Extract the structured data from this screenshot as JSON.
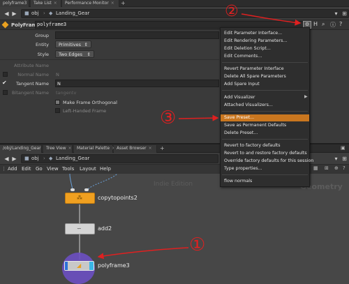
{
  "top_tabs": [
    {
      "label": "polyframe3"
    },
    {
      "label": "Take List"
    },
    {
      "label": "Performance Monitor"
    }
  ],
  "nav": {
    "path_root": "obj",
    "path_node": "Landing_Gear"
  },
  "param_header": {
    "node_type": "PolyFrame",
    "node_name": "polyframe3"
  },
  "params": {
    "group_label": "Group",
    "entity_label": "Entity",
    "entity_value": "Primitives",
    "style_label": "Style",
    "style_value": "Two Edges",
    "attribute_name_label": "Attribute Name",
    "normal_name_label": "Normal Name",
    "normal_name_value": "N",
    "tangent_name_label": "Tangent Name",
    "tangent_name_value": "N",
    "bitangent_name_label": "Bitangent Name",
    "bitangent_name_value": "tangentv",
    "make_frame_orthogonal": "Make Frame Orthogonal",
    "left_handed_frame": "Left-Handed Frame"
  },
  "context_menu": {
    "items": [
      {
        "label": "Edit Parameter Interface..."
      },
      {
        "label": "Edit Rendering Parameters..."
      },
      {
        "label": "Edit Deletion Script..."
      },
      {
        "label": "Edit Comments..."
      },
      {
        "label": "Revert Parameter Interface"
      },
      {
        "label": "Delete All Spare Parameters"
      },
      {
        "label": "Add Spare Input"
      },
      {
        "label": "Add Visualizer"
      },
      {
        "label": "Attached Visualizers..."
      },
      {
        "label": "Save Preset..."
      },
      {
        "label": "Save as Permanent Defaults"
      },
      {
        "label": "Delete Preset..."
      },
      {
        "label": "Revert to factory defaults"
      },
      {
        "label": "Revert to and restore factory defaults"
      },
      {
        "label": "Override factory defaults for this session"
      },
      {
        "label": "Type properties..."
      },
      {
        "label": "flow normals"
      }
    ]
  },
  "pane2_tabs": [
    {
      "label": "/obj/Landing_Gear"
    },
    {
      "label": "Tree View"
    },
    {
      "label": "Material Palette"
    },
    {
      "label": "Asset Browser"
    }
  ],
  "nav2": {
    "path_root": "obj",
    "path_node": "Landing_Gear"
  },
  "network_menu": [
    "Add",
    "Edit",
    "Go",
    "View",
    "Tools",
    "Layout",
    "Help"
  ],
  "network": {
    "watermark": "Indie Edition",
    "context_label": "Geometry",
    "nodes": [
      {
        "name": "copytopoints2"
      },
      {
        "name": "add2"
      },
      {
        "name": "polyframe3"
      }
    ]
  },
  "annotations": {
    "one": "①",
    "two": "②",
    "three": "③"
  },
  "colors": {
    "menu_highlight": "#c9761f",
    "copy_node": "#f0a020",
    "annotation": "#e02020"
  }
}
